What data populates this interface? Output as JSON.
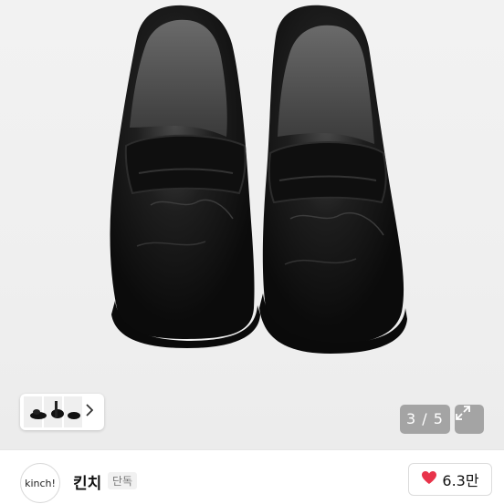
{
  "gallery": {
    "counter_current": "3",
    "counter_total": "5",
    "expand_icon": "expand-arrows-icon",
    "thumbnail_arrow_icon": "chevron-right-icon"
  },
  "seller": {
    "avatar_text": "kinch!",
    "name": "킨치",
    "badge": "단독"
  },
  "like": {
    "icon": "heart-icon",
    "count": "6.3만",
    "color": "#e8334a"
  },
  "colors": {
    "background": "#f0f0f0",
    "shoe": "#151515"
  }
}
